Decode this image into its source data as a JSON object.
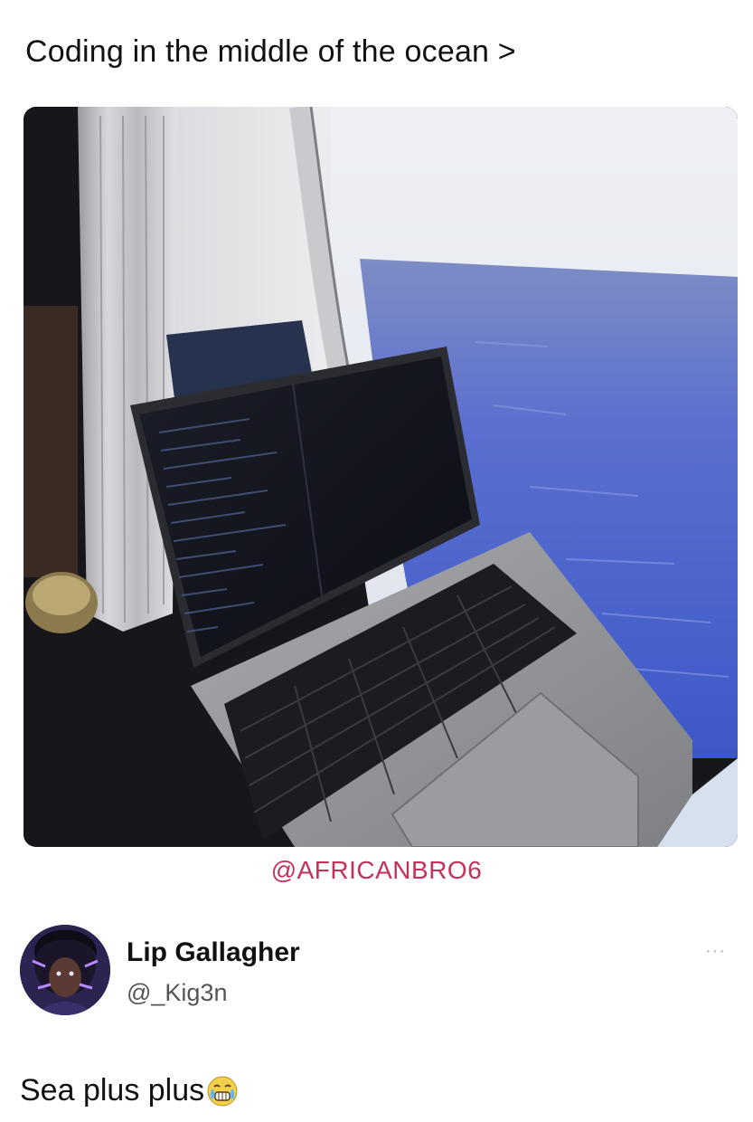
{
  "post": {
    "title": "Coding in the middle of the ocean >",
    "watermark": "@AFRICANBRO6",
    "photo_icon": "laptop-by-ocean-window-photo"
  },
  "reply": {
    "author": {
      "name": "Lip Gallagher",
      "handle": "@_Kig3n",
      "avatar_icon": "avatar-icon"
    },
    "more_label": "···",
    "text": "Sea plus plus",
    "emoji_icon": "grimacing-tears-emoji-icon"
  },
  "colors": {
    "watermark": "#c3325a",
    "sea": "#4c63c9",
    "sky": "#e9ecf3"
  }
}
